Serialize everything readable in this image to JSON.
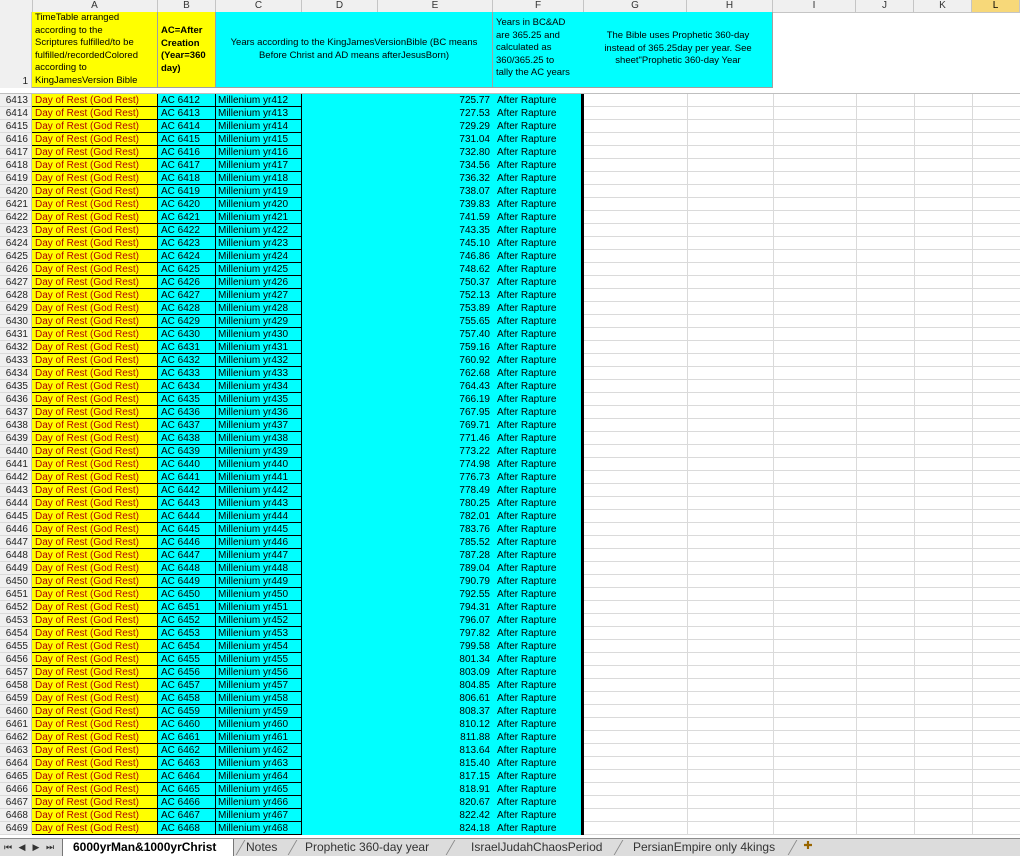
{
  "columns": [
    "A",
    "B",
    "C",
    "D",
    "E",
    "F",
    "G",
    "H",
    "I",
    "J",
    "K",
    "L"
  ],
  "header_row": {
    "row_number": "1",
    "a": [
      "TimeTable arranged",
      "according to the",
      "Scriptures fulfilled/to be",
      "fulfilled/recordedColored",
      "according to",
      "KingJamesVersion Bible"
    ],
    "b": [
      "AC=After",
      "Creation",
      "(Year=360",
      "day)"
    ],
    "c_to_e": [
      "Years according to the KingJamesVersionBible (BC means",
      "Before Christ and AD means afterJesusBorn)"
    ],
    "f": [
      "Years in BC&AD",
      "are 365.25 and",
      "calculated as",
      "360/365.25 to",
      "tally the AC years"
    ],
    "g_h": [
      "The Bible uses Prophetic 360-day",
      "instead of 365.25day per year. See",
      "sheet\"Prophetic 360-day Year"
    ]
  },
  "rows": [
    {
      "rn": "6413",
      "a": "Day of Rest (God Rest)",
      "b": "AC 6412",
      "c": "Millenium yr412",
      "e": "725.77",
      "f": "After Rapture"
    },
    {
      "rn": "6414",
      "a": "Day of Rest (God Rest)",
      "b": "AC 6413",
      "c": "Millenium yr413",
      "e": "727.53",
      "f": "After Rapture"
    },
    {
      "rn": "6415",
      "a": "Day of Rest (God Rest)",
      "b": "AC 6414",
      "c": "Millenium yr414",
      "e": "729.29",
      "f": "After Rapture"
    },
    {
      "rn": "6416",
      "a": "Day of Rest (God Rest)",
      "b": "AC 6415",
      "c": "Millenium yr415",
      "e": "731.04",
      "f": "After Rapture"
    },
    {
      "rn": "6417",
      "a": "Day of Rest (God Rest)",
      "b": "AC 6416",
      "c": "Millenium yr416",
      "e": "732.80",
      "f": "After Rapture"
    },
    {
      "rn": "6418",
      "a": "Day of Rest (God Rest)",
      "b": "AC 6417",
      "c": "Millenium yr417",
      "e": "734.56",
      "f": "After Rapture"
    },
    {
      "rn": "6419",
      "a": "Day of Rest (God Rest)",
      "b": "AC 6418",
      "c": "Millenium yr418",
      "e": "736.32",
      "f": "After Rapture"
    },
    {
      "rn": "6420",
      "a": "Day of Rest (God Rest)",
      "b": "AC 6419",
      "c": "Millenium yr419",
      "e": "738.07",
      "f": "After Rapture"
    },
    {
      "rn": "6421",
      "a": "Day of Rest (God Rest)",
      "b": "AC 6420",
      "c": "Millenium yr420",
      "e": "739.83",
      "f": "After Rapture"
    },
    {
      "rn": "6422",
      "a": "Day of Rest (God Rest)",
      "b": "AC 6421",
      "c": "Millenium yr421",
      "e": "741.59",
      "f": "After Rapture"
    },
    {
      "rn": "6423",
      "a": "Day of Rest (God Rest)",
      "b": "AC 6422",
      "c": "Millenium yr422",
      "e": "743.35",
      "f": "After Rapture"
    },
    {
      "rn": "6424",
      "a": "Day of Rest (God Rest)",
      "b": "AC 6423",
      "c": "Millenium yr423",
      "e": "745.10",
      "f": "After Rapture"
    },
    {
      "rn": "6425",
      "a": "Day of Rest (God Rest)",
      "b": "AC 6424",
      "c": "Millenium yr424",
      "e": "746.86",
      "f": "After Rapture"
    },
    {
      "rn": "6426",
      "a": "Day of Rest (God Rest)",
      "b": "AC 6425",
      "c": "Millenium yr425",
      "e": "748.62",
      "f": "After Rapture"
    },
    {
      "rn": "6427",
      "a": "Day of Rest (God Rest)",
      "b": "AC 6426",
      "c": "Millenium yr426",
      "e": "750.37",
      "f": "After Rapture"
    },
    {
      "rn": "6428",
      "a": "Day of Rest (God Rest)",
      "b": "AC 6427",
      "c": "Millenium yr427",
      "e": "752.13",
      "f": "After Rapture"
    },
    {
      "rn": "6429",
      "a": "Day of Rest (God Rest)",
      "b": "AC 6428",
      "c": "Millenium yr428",
      "e": "753.89",
      "f": "After Rapture"
    },
    {
      "rn": "6430",
      "a": "Day of Rest (God Rest)",
      "b": "AC 6429",
      "c": "Millenium yr429",
      "e": "755.65",
      "f": "After Rapture"
    },
    {
      "rn": "6431",
      "a": "Day of Rest (God Rest)",
      "b": "AC 6430",
      "c": "Millenium yr430",
      "e": "757.40",
      "f": "After Rapture"
    },
    {
      "rn": "6432",
      "a": "Day of Rest (God Rest)",
      "b": "AC 6431",
      "c": "Millenium yr431",
      "e": "759.16",
      "f": "After Rapture"
    },
    {
      "rn": "6433",
      "a": "Day of Rest (God Rest)",
      "b": "AC 6432",
      "c": "Millenium yr432",
      "e": "760.92",
      "f": "After Rapture"
    },
    {
      "rn": "6434",
      "a": "Day of Rest (God Rest)",
      "b": "AC 6433",
      "c": "Millenium yr433",
      "e": "762.68",
      "f": "After Rapture"
    },
    {
      "rn": "6435",
      "a": "Day of Rest (God Rest)",
      "b": "AC 6434",
      "c": "Millenium yr434",
      "e": "764.43",
      "f": "After Rapture"
    },
    {
      "rn": "6436",
      "a": "Day of Rest (God Rest)",
      "b": "AC 6435",
      "c": "Millenium yr435",
      "e": "766.19",
      "f": "After Rapture"
    },
    {
      "rn": "6437",
      "a": "Day of Rest (God Rest)",
      "b": "AC 6436",
      "c": "Millenium yr436",
      "e": "767.95",
      "f": "After Rapture"
    },
    {
      "rn": "6438",
      "a": "Day of Rest (God Rest)",
      "b": "AC 6437",
      "c": "Millenium yr437",
      "e": "769.71",
      "f": "After Rapture"
    },
    {
      "rn": "6439",
      "a": "Day of Rest (God Rest)",
      "b": "AC 6438",
      "c": "Millenium yr438",
      "e": "771.46",
      "f": "After Rapture"
    },
    {
      "rn": "6440",
      "a": "Day of Rest (God Rest)",
      "b": "AC 6439",
      "c": "Millenium yr439",
      "e": "773.22",
      "f": "After Rapture"
    },
    {
      "rn": "6441",
      "a": "Day of Rest (God Rest)",
      "b": "AC 6440",
      "c": "Millenium yr440",
      "e": "774.98",
      "f": "After Rapture"
    },
    {
      "rn": "6442",
      "a": "Day of Rest (God Rest)",
      "b": "AC 6441",
      "c": "Millenium yr441",
      "e": "776.73",
      "f": "After Rapture"
    },
    {
      "rn": "6443",
      "a": "Day of Rest (God Rest)",
      "b": "AC 6442",
      "c": "Millenium yr442",
      "e": "778.49",
      "f": "After Rapture"
    },
    {
      "rn": "6444",
      "a": "Day of Rest (God Rest)",
      "b": "AC 6443",
      "c": "Millenium yr443",
      "e": "780.25",
      "f": "After Rapture"
    },
    {
      "rn": "6445",
      "a": "Day of Rest (God Rest)",
      "b": "AC 6444",
      "c": "Millenium yr444",
      "e": "782.01",
      "f": "After Rapture"
    },
    {
      "rn": "6446",
      "a": "Day of Rest (God Rest)",
      "b": "AC 6445",
      "c": "Millenium yr445",
      "e": "783.76",
      "f": "After Rapture"
    },
    {
      "rn": "6447",
      "a": "Day of Rest (God Rest)",
      "b": "AC 6446",
      "c": "Millenium yr446",
      "e": "785.52",
      "f": "After Rapture"
    },
    {
      "rn": "6448",
      "a": "Day of Rest (God Rest)",
      "b": "AC 6447",
      "c": "Millenium yr447",
      "e": "787.28",
      "f": "After Rapture"
    },
    {
      "rn": "6449",
      "a": "Day of Rest (God Rest)",
      "b": "AC 6448",
      "c": "Millenium yr448",
      "e": "789.04",
      "f": "After Rapture"
    },
    {
      "rn": "6450",
      "a": "Day of Rest (God Rest)",
      "b": "AC 6449",
      "c": "Millenium yr449",
      "e": "790.79",
      "f": "After Rapture"
    },
    {
      "rn": "6451",
      "a": "Day of Rest (God Rest)",
      "b": "AC 6450",
      "c": "Millenium yr450",
      "e": "792.55",
      "f": "After Rapture"
    },
    {
      "rn": "6452",
      "a": "Day of Rest (God Rest)",
      "b": "AC 6451",
      "c": "Millenium yr451",
      "e": "794.31",
      "f": "After Rapture"
    },
    {
      "rn": "6453",
      "a": "Day of Rest (God Rest)",
      "b": "AC 6452",
      "c": "Millenium yr452",
      "e": "796.07",
      "f": "After Rapture"
    },
    {
      "rn": "6454",
      "a": "Day of Rest (God Rest)",
      "b": "AC 6453",
      "c": "Millenium yr453",
      "e": "797.82",
      "f": "After Rapture"
    },
    {
      "rn": "6455",
      "a": "Day of Rest (God Rest)",
      "b": "AC 6454",
      "c": "Millenium yr454",
      "e": "799.58",
      "f": "After Rapture"
    },
    {
      "rn": "6456",
      "a": "Day of Rest (God Rest)",
      "b": "AC 6455",
      "c": "Millenium yr455",
      "e": "801.34",
      "f": "After Rapture"
    },
    {
      "rn": "6457",
      "a": "Day of Rest (God Rest)",
      "b": "AC 6456",
      "c": "Millenium yr456",
      "e": "803.09",
      "f": "After Rapture"
    },
    {
      "rn": "6458",
      "a": "Day of Rest (God Rest)",
      "b": "AC 6457",
      "c": "Millenium yr457",
      "e": "804.85",
      "f": "After Rapture"
    },
    {
      "rn": "6459",
      "a": "Day of Rest (God Rest)",
      "b": "AC 6458",
      "c": "Millenium yr458",
      "e": "806.61",
      "f": "After Rapture"
    },
    {
      "rn": "6460",
      "a": "Day of Rest (God Rest)",
      "b": "AC 6459",
      "c": "Millenium yr459",
      "e": "808.37",
      "f": "After Rapture"
    },
    {
      "rn": "6461",
      "a": "Day of Rest (God Rest)",
      "b": "AC 6460",
      "c": "Millenium yr460",
      "e": "810.12",
      "f": "After Rapture"
    },
    {
      "rn": "6462",
      "a": "Day of Rest (God Rest)",
      "b": "AC 6461",
      "c": "Millenium yr461",
      "e": "811.88",
      "f": "After Rapture"
    },
    {
      "rn": "6463",
      "a": "Day of Rest (God Rest)",
      "b": "AC 6462",
      "c": "Millenium yr462",
      "e": "813.64",
      "f": "After Rapture"
    },
    {
      "rn": "6464",
      "a": "Day of Rest (God Rest)",
      "b": "AC 6463",
      "c": "Millenium yr463",
      "e": "815.40",
      "f": "After Rapture"
    },
    {
      "rn": "6465",
      "a": "Day of Rest (God Rest)",
      "b": "AC 6464",
      "c": "Millenium yr464",
      "e": "817.15",
      "f": "After Rapture"
    },
    {
      "rn": "6466",
      "a": "Day of Rest (God Rest)",
      "b": "AC 6465",
      "c": "Millenium yr465",
      "e": "818.91",
      "f": "After Rapture"
    },
    {
      "rn": "6467",
      "a": "Day of Rest (God Rest)",
      "b": "AC 6466",
      "c": "Millenium yr466",
      "e": "820.67",
      "f": "After Rapture"
    },
    {
      "rn": "6468",
      "a": "Day of Rest (God Rest)",
      "b": "AC 6467",
      "c": "Millenium yr467",
      "e": "822.42",
      "f": "After Rapture"
    },
    {
      "rn": "6469",
      "a": "Day of Rest (God Rest)",
      "b": "AC 6468",
      "c": "Millenium yr468",
      "e": "824.18",
      "f": "After Rapture"
    }
  ],
  "sheet_tabs": [
    {
      "label": "6000yrMan&1000yrChrist",
      "active": true
    },
    {
      "label": "Notes",
      "active": false
    },
    {
      "label": "Prophetic 360-day year",
      "active": false
    },
    {
      "label": "IsraelJudahChaosPeriod",
      "active": false
    },
    {
      "label": "PersianEmpire only 4kings",
      "active": false
    }
  ],
  "colors": {
    "yellow": "#ffff00",
    "cyan": "#00ffff",
    "red_text": "#b00000"
  }
}
